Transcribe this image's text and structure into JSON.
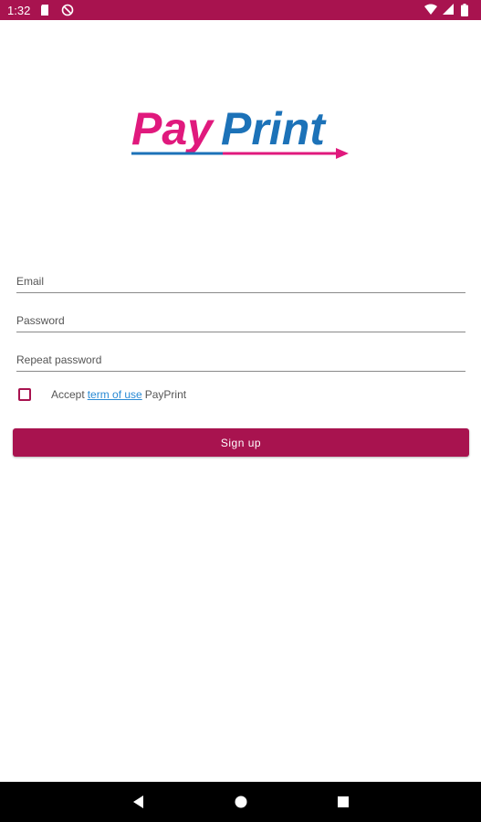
{
  "status_bar": {
    "time": "1:32",
    "icons": [
      "sd-card-icon",
      "sync-disabled-icon",
      "wifi-icon",
      "signal-icon",
      "battery-icon"
    ]
  },
  "logo": {
    "text_pay": "Pay",
    "text_print": "Print",
    "colors": {
      "pay": "#e0197d",
      "print": "#1c72b8",
      "arrow": "#e0197d",
      "underline": "#1c72b8"
    }
  },
  "form": {
    "email_placeholder": "Email",
    "email_value": "",
    "password_placeholder": "Password",
    "password_value": "",
    "repeat_password_placeholder": "Repeat password",
    "repeat_password_value": "",
    "accept_prefix": "Accept",
    "terms_link": "term of use",
    "accept_suffix": "PayPrint",
    "accept_checked": false,
    "signup_label": "Sign up"
  },
  "nav": {
    "icons": [
      "back-icon",
      "home-icon",
      "recents-icon"
    ]
  },
  "colors": {
    "primary": "#a8134f",
    "link": "#2a8ad4"
  }
}
